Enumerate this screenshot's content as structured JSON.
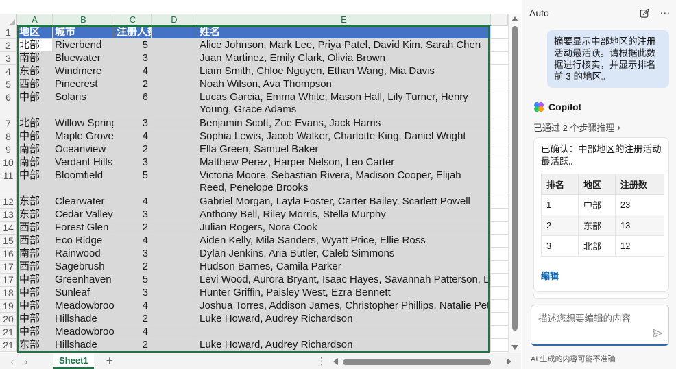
{
  "sheet": {
    "columns": [
      "A",
      "B",
      "C",
      "D",
      "E"
    ],
    "header_row": {
      "num": "1",
      "a": "地区",
      "b": "城市",
      "c": "注册人数",
      "d": "",
      "e": "姓名"
    },
    "rows": [
      {
        "num": "2",
        "a": "北部",
        "b": "Riverbend",
        "c": "5",
        "e": "Alice Johnson, Mark Lee, Priya Patel, David Kim, Sarah Chen"
      },
      {
        "num": "3",
        "a": "南部",
        "b": "Bluewater",
        "c": "3",
        "e": "Juan Martinez, Emily Clark, Olivia Brown"
      },
      {
        "num": "4",
        "a": "东部",
        "b": "Windmere",
        "c": "4",
        "e": "Liam Smith, Chloe Nguyen, Ethan Wang, Mia Davis"
      },
      {
        "num": "5",
        "a": "西部",
        "b": "Pinecrest",
        "c": "2",
        "e": "Noah Wilson, Ava Thompson"
      },
      {
        "num": "6",
        "a": "中部",
        "b": "Solaris",
        "c": "6",
        "e": "Lucas Garcia, Emma White, Mason Hall, Lily Turner, Henry Young, Grace Adams"
      },
      {
        "num": "7",
        "a": "北部",
        "b": "Willow Spring",
        "c": "3",
        "e": "Benjamin Scott, Zoe Evans, Jack Harris"
      },
      {
        "num": "8",
        "a": "中部",
        "b": "Maple Grove",
        "c": "4",
        "e": "Sophia Lewis, Jacob Walker, Charlotte King, Daniel Wright"
      },
      {
        "num": "9",
        "a": "南部",
        "b": "Oceanview",
        "c": "2",
        "e": "Ella Green, Samuel Baker"
      },
      {
        "num": "10",
        "a": "南部",
        "b": "Verdant Hills",
        "c": "3",
        "e": "Matthew Perez, Harper Nelson, Leo Carter"
      },
      {
        "num": "11",
        "a": "中部",
        "b": "Bloomfield",
        "c": "5",
        "e": "Victoria Moore, Sebastian Rivera, Madison Cooper, Elijah Reed, Penelope Brooks"
      },
      {
        "num": "12",
        "a": "东部",
        "b": "Clearwater",
        "c": "4",
        "e": "Gabriel Morgan, Layla Foster, Carter Bailey, Scarlett Powell"
      },
      {
        "num": "13",
        "a": "东部",
        "b": "Cedar Valley",
        "c": "3",
        "e": "Anthony Bell, Riley Morris, Stella Murphy"
      },
      {
        "num": "14",
        "a": "西部",
        "b": "Forest Glen",
        "c": "2",
        "e": "Julian Rogers, Nora Cook"
      },
      {
        "num": "15",
        "a": "西部",
        "b": "Eco Ridge",
        "c": "4",
        "e": "Aiden Kelly, Mila Sanders, Wyatt Price, Ellie Ross"
      },
      {
        "num": "16",
        "a": "南部",
        "b": "Rainwood",
        "c": "3",
        "e": "Dylan Jenkins, Aria Butler, Caleb Simmons"
      },
      {
        "num": "17",
        "a": "西部",
        "b": "Sagebrush",
        "c": "2",
        "e": "Hudson Barnes, Camila Parker"
      },
      {
        "num": "17",
        "a": "中部",
        "b": "Greenhaven",
        "c": "5",
        "e": "Levi Wood, Aurora Bryant, Isaac Hayes, Savannah Patterson, Lincoln Russell"
      },
      {
        "num": "18",
        "a": "中部",
        "b": "Sunleaf",
        "c": "3",
        "e": "Hunter Griffin, Paisley West, Ezra Bennett"
      },
      {
        "num": "19",
        "a": "中部",
        "b": "Meadowbrook",
        "c": "4",
        "e": "Joshua Torres, Addison James, Christopher Phillips, Natalie Peterson"
      },
      {
        "num": "20",
        "a": "中部",
        "b": "Hillshade",
        "c": "2",
        "e": "Luke Howard, Audrey Richardson"
      },
      {
        "num": "21",
        "a": "中部",
        "b": "Meadowbrook",
        "c": "4",
        "e": ""
      },
      {
        "num": "21",
        "a": "东部",
        "b": "Hillshade",
        "c": "2",
        "e": "Luke Howard, Audrey Richardson"
      }
    ],
    "tab_name": "Sheet1",
    "colors": {
      "header_fill": "#4472c4",
      "selection_border": "#217346",
      "cell_fill": "#d9d9d9"
    }
  },
  "copilot": {
    "pane_title": "Auto",
    "user_message": "摘要显示中部地区的注册活动最活跃。请根据此数据进行核实，并显示排名前 3 的地区。",
    "assistant_name": "Copilot",
    "reasoning_label": "已通过 2 个步骤推理",
    "answer_text": "已确认：中部地区的注册活动最活跃。",
    "table_headers": [
      "排名",
      "地区",
      "注册数"
    ],
    "table_rows": [
      [
        "1",
        "中部",
        "23"
      ],
      [
        "2",
        "东部",
        "13"
      ],
      [
        "3",
        "北部",
        "12"
      ]
    ],
    "edit_label": "编辑",
    "input_placeholder": "描述您想要编辑的内容",
    "disclaimer": "AI 生成的内容可能不准确"
  }
}
